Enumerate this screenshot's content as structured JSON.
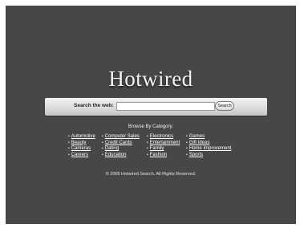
{
  "brand": {
    "logo_text": "Hotwired"
  },
  "search": {
    "label": "Search the web:",
    "input_value": "",
    "button_label": "Search"
  },
  "categories": {
    "heading": "Browse By Category:",
    "columns": [
      [
        "Automotive",
        "Beauty",
        "Cameras",
        "Careers"
      ],
      [
        "Computer Sales",
        "Credit Cards",
        "Dating",
        "Education"
      ],
      [
        "Electronics",
        "Entertainment",
        "Family",
        "Fashion"
      ],
      [
        "Games",
        "Gift Ideas",
        "Home Improvement",
        "Sports"
      ]
    ]
  },
  "footer": {
    "copyright": "© 2006 Hotwired Search. All Rights Reserved."
  },
  "colors": {
    "background": "#474747",
    "outer_border": "#ffffff",
    "search_bar": "#d6d6d6",
    "text": "#ffffff"
  }
}
